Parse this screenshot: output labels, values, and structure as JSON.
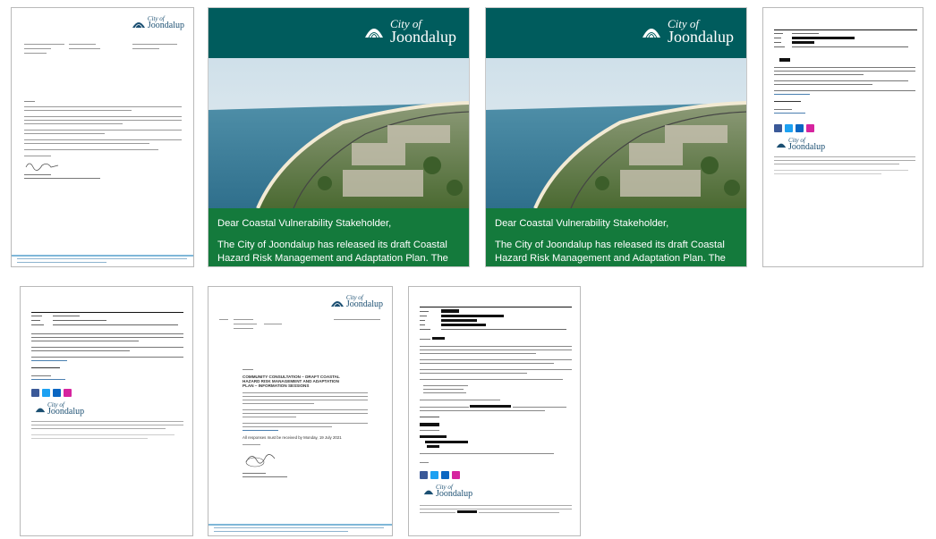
{
  "logo": {
    "line1": "City of",
    "line2": "Joondalup"
  },
  "flyer": {
    "salutation": "Dear Coastal Vulnerability Stakeholder,",
    "body": "The City of Joondalup has released its draft Coastal Hazard Risk Management and Adaptation Plan. The City is holding community information sessions to provide an overview of the draft Plan and answer community questions about the City’s future coastal management actions."
  },
  "letter2": {
    "heading": "COMMUNITY CONSULTATION – DRAFT COASTAL HAZARD RISK MANAGEMENT AND ADAPTATION PLAN – INFORMATION SESSIONS",
    "closing": "All responses must be received by Monday, 19 July 2021"
  },
  "email": {
    "from_label": "From:",
    "subject_label": "Subject:"
  },
  "colors": {
    "teal": "#005c5d",
    "green": "#147a3c",
    "logo_blue": "#1b4f72"
  },
  "icons": [
    "city-logo-icon",
    "facebook-icon",
    "twitter-icon",
    "linkedin-icon",
    "instagram-icon",
    "signature-icon"
  ]
}
